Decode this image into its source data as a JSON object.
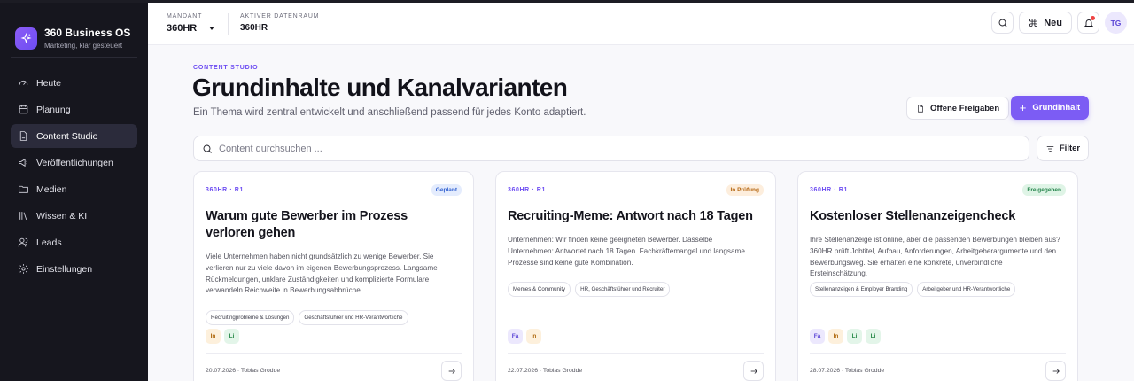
{
  "brand": {
    "title": "360 Business OS",
    "subtitle": "Marketing, klar gesteuert"
  },
  "nav": [
    {
      "label": "Heute",
      "icon": "gauge-icon"
    },
    {
      "label": "Planung",
      "icon": "calendar-icon"
    },
    {
      "label": "Content Studio",
      "icon": "document-icon",
      "active": true
    },
    {
      "label": "Veröffentlichungen",
      "icon": "megaphone-icon"
    },
    {
      "label": "Medien",
      "icon": "folder-icon"
    },
    {
      "label": "Wissen & KI",
      "icon": "library-icon"
    },
    {
      "label": "Leads",
      "icon": "users-icon"
    },
    {
      "label": "Einstellungen",
      "icon": "gear-icon"
    }
  ],
  "header": {
    "mandant_label": "Mandant",
    "mandant_value": "360HR",
    "datenraum_label": "Aktiver Datenraum",
    "datenraum_value": "360HR",
    "new_label": "Neu",
    "avatar_initials": "TG"
  },
  "page": {
    "eyebrow": "Content Studio",
    "title": "Grundinhalte und Kanalvarianten",
    "subtitle": "Ein Thema wird zentral entwickelt und anschließend passend für jedes Konto adaptiert.",
    "releases_label": "Offene Freigaben",
    "create_label": "Grundinhalt",
    "search_placeholder": "Content durchsuchen ...",
    "filter_label": "Filter"
  },
  "colors": {
    "accent": "#7c5cf4",
    "sidebar_bg": "#16161e"
  },
  "cards": [
    {
      "meta": "360HR · R1",
      "status": "Geplant",
      "status_bg": "#e4ecfd",
      "status_color": "#2f5fd0",
      "title": "Warum gute Bewerber im Prozess verloren gehen",
      "body": "Viele Unternehmen haben nicht grundsätzlich zu wenige Bewerber. Sie verlieren nur zu viele davon im eigenen Bewerbungsprozess. Langsame Rückmeldungen, unklare Zuständigkeiten und komplizierte Formulare verwandeln Reichweite in Bewerbungsabbrüche.",
      "tags": [
        "Recruitingprobleme & Lösungen",
        "Geschäftsführer und HR-Verantwortliche"
      ],
      "channels": [
        "In",
        "Li"
      ],
      "footer": "20.07.2026 · Tobias Grodde"
    },
    {
      "meta": "360HR · R1",
      "status": "In Prüfung",
      "status_bg": "#fdeedd",
      "status_color": "#b4650f",
      "title": "Recruiting-Meme: Antwort nach 18 Tagen",
      "body": "Unternehmen: Wir finden keine geeigneten Bewerber. Dasselbe Unternehmen: Antwortet nach 18 Tagen. Fachkräftemangel und langsame Prozesse sind keine gute Kombination.",
      "tags": [
        "Memes & Community",
        "HR, Geschäftsführer und Recruiter"
      ],
      "channels": [
        "Fa",
        "In"
      ],
      "footer": "22.07.2026 · Tobias Grodde"
    },
    {
      "meta": "360HR · R1",
      "status": "Freigegeben",
      "status_bg": "#dff4e6",
      "status_color": "#23834a",
      "title": "Kostenloser Stellenanzeigencheck",
      "body": "Ihre Stellenanzeige ist online, aber die passenden Bewerbungen bleiben aus? 360HR prüft Jobtitel, Aufbau, Anforderungen, Arbeitgeberargumente und den Bewerbungsweg. Sie erhalten eine konkrete, unverbindliche Ersteinschätzung.",
      "tags": [
        "Stellenanzeigen & Employer Branding",
        "Arbeitgeber und HR-Verantwortliche"
      ],
      "channels": [
        "Fa",
        "In",
        "Li",
        "Li"
      ],
      "footer": "28.07.2026 · Tobias Grodde"
    }
  ]
}
